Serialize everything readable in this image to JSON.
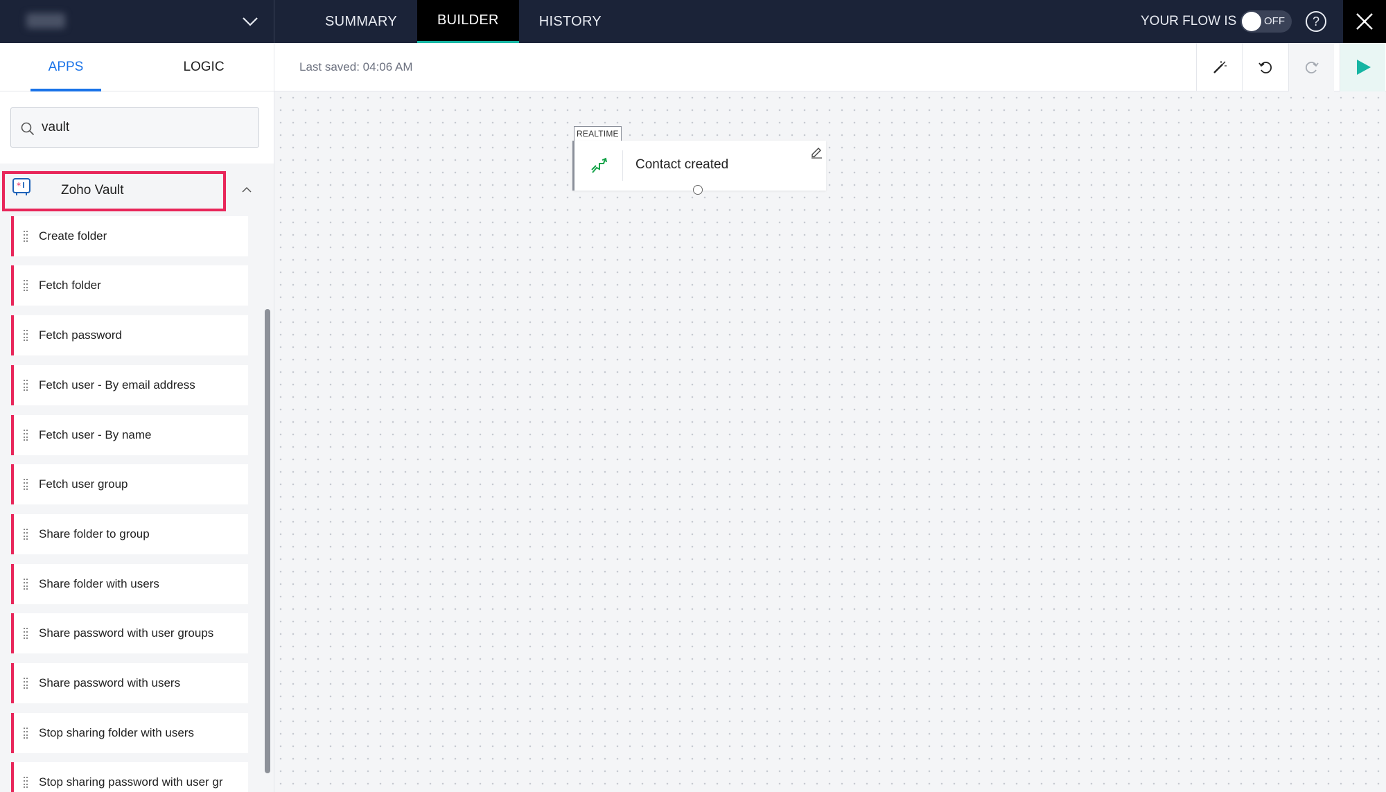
{
  "topbar": {
    "tabs": [
      {
        "label": "SUMMARY"
      },
      {
        "label": "BUILDER"
      },
      {
        "label": "HISTORY"
      }
    ],
    "flow_status_label": "YOUR FLOW IS",
    "toggle_label": "OFF",
    "help_label": "?"
  },
  "subbar": {
    "apps_tab": "APPS",
    "logic_tab": "LOGIC",
    "last_saved": "Last saved: 04:06 AM"
  },
  "sidebar": {
    "search": {
      "value": "vault"
    },
    "app_name": "Zoho Vault",
    "actions": [
      {
        "label": "Create folder"
      },
      {
        "label": "Fetch folder"
      },
      {
        "label": "Fetch password"
      },
      {
        "label": "Fetch user - By email address"
      },
      {
        "label": "Fetch user - By name"
      },
      {
        "label": "Fetch user group"
      },
      {
        "label": "Share folder to group"
      },
      {
        "label": "Share folder with users"
      },
      {
        "label": "Share password with user groups"
      },
      {
        "label": "Share password with users"
      },
      {
        "label": "Stop sharing folder with users"
      },
      {
        "label": "Stop sharing password with user gr"
      }
    ]
  },
  "canvas": {
    "trigger": {
      "tag": "REALTIME",
      "title": "Contact created"
    }
  },
  "colors": {
    "topbar_bg": "#1b2338",
    "accent": "#1a73e8",
    "active_underline": "#16b5a3",
    "action_stripe": "#e8265a",
    "run_green": "#16b5a3"
  },
  "icons": [
    "chevron-down-icon",
    "close-icon",
    "help-icon",
    "magic-wand-icon",
    "undo-icon",
    "redo-icon",
    "play-icon",
    "search-icon",
    "zoho-vault-icon",
    "chevron-up-icon",
    "drag-handle-icon",
    "contact-icon",
    "edit-icon"
  ]
}
